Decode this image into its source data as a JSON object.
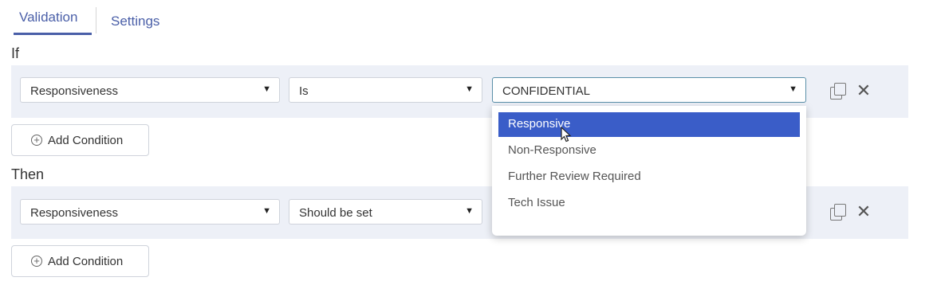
{
  "tabs": {
    "validation": "Validation",
    "settings": "Settings"
  },
  "if_section": {
    "label": "If",
    "field": "Responsiveness",
    "operator": "Is",
    "value": "CONFIDENTIAL",
    "add_condition": "Add Condition"
  },
  "then_section": {
    "label": "Then",
    "field": "Responsiveness",
    "operator": "Should be set",
    "add_condition": "Add Condition"
  },
  "dropdown": {
    "options": [
      "Responsive",
      "Non-Responsive",
      "Further Review Required",
      "Tech Issue"
    ],
    "highlighted": "Responsive"
  },
  "icons": {
    "copy": "copy-icon",
    "close": "close-icon",
    "plus": "plus-circle-icon",
    "caret": "caret-down-icon"
  },
  "colors": {
    "accent": "#4a5fa8",
    "highlight": "#3a5dc8",
    "row_bg": "#edf0f7"
  }
}
